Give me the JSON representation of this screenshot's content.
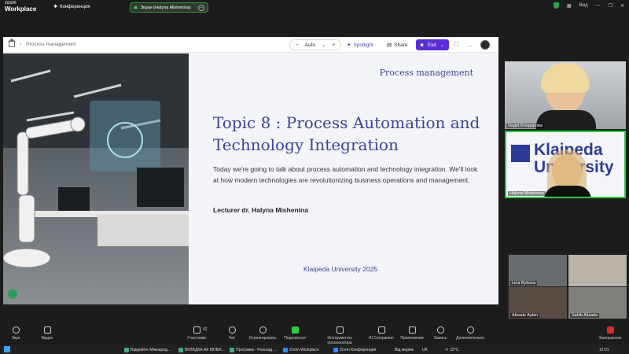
{
  "app": {
    "logo_top": "zoom",
    "logo_bottom": "Workplace",
    "conference": "Конференция"
  },
  "screen_share": {
    "label": "Экран (Halyna Mishenina)"
  },
  "topbar_right": {
    "view": "Вид"
  },
  "slide_toolbar": {
    "breadcrumb": "Process management",
    "zoom_minus": "−",
    "zoom_value": "Auto",
    "zoom_plus": "+",
    "spotlight": "Spotlight",
    "share": "Share",
    "exit": "Exit",
    "more": "…"
  },
  "slide": {
    "header_label": "Process management",
    "title": "Topic 8 : Process Automation and Technology Integration",
    "description": "Today we're going to talk about process automation and technology integration. We'll look at how modern technologies are revolutionizing business operations and management.",
    "lecturer": "Lecturer dr.  Halyna Mishenina",
    "university": "Klaipeda University  2025"
  },
  "participants": [
    {
      "name": "Надія Бондарова"
    },
    {
      "name": "Halyna Mishenina",
      "banner": "Klaipeda University"
    },
    {
      "name": "Lina Bykova"
    },
    {
      "name": "Alisade Ayten"
    },
    {
      "name": "Sahib Alizade"
    }
  ],
  "participant_count": "42",
  "controls": [
    {
      "label": "Звук",
      "icon": "microphone-icon"
    },
    {
      "label": "Видео",
      "icon": "camera-icon"
    },
    {
      "label": "Участники",
      "icon": "participants-icon"
    },
    {
      "label": "Чат",
      "icon": "chat-icon"
    },
    {
      "label": "Отреагировать",
      "icon": "heart-icon"
    },
    {
      "label": "Поделиться",
      "icon": "share-icon"
    },
    {
      "label": "Инструменты организатора",
      "icon": "shield-icon"
    },
    {
      "label": "AI Companion",
      "icon": "sparkle-icon"
    },
    {
      "label": "Приложения",
      "icon": "apps-icon"
    },
    {
      "label": "Запись",
      "icon": "record-icon"
    },
    {
      "label": "Дополнительно",
      "icon": "more-icon"
    },
    {
      "label": "Завершение",
      "icon": "end-icon"
    }
  ],
  "taskbar": {
    "items": [
      "Відкрийте Міжнарод...",
      "ВКЛАДКА АК МОБИ...",
      "Програма - Розклад ...",
      "Zoom Workplace",
      "Zoom Конференция"
    ],
    "search": "Від мереж",
    "lang": "UK",
    "weather": "15°C",
    "time": "12:01"
  },
  "colors": {
    "accent": "#3b4595",
    "exit_button": "#5a2dd6",
    "active_speaker": "#2ecc40"
  }
}
